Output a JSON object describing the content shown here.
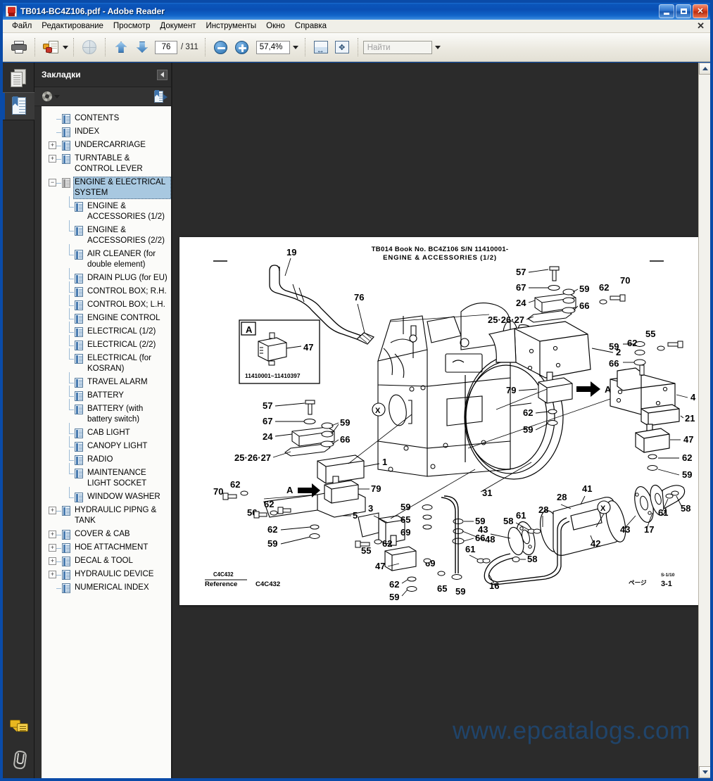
{
  "window": {
    "title": "TB014-BC4Z106.pdf - Adobe Reader",
    "app_icon": "pdf-icon",
    "minimize_label": "_",
    "maximize_label": "□",
    "close_label": "✕"
  },
  "menu": {
    "items": [
      {
        "label": "Файл",
        "accel": "Ф"
      },
      {
        "label": "Редактирование",
        "accel": "Р"
      },
      {
        "label": "Просмотр",
        "accel": "П"
      },
      {
        "label": "Документ",
        "accel": "Д"
      },
      {
        "label": "Инструменты",
        "accel": "И"
      },
      {
        "label": "Окно",
        "accel": "О"
      },
      {
        "label": "Справка",
        "accel": "С"
      }
    ],
    "close_toolbar_label": "✕"
  },
  "toolbar": {
    "print_icon": "printer-icon",
    "share_icon": "email-share-icon",
    "web_capture_icon": "globe-icon",
    "prev_page_icon": "arrow-up-icon",
    "next_page_icon": "arrow-down-icon",
    "current_page": "76",
    "page_total": "/ 311",
    "zoom_out_icon": "zoom-out-icon",
    "zoom_in_icon": "zoom-in-icon",
    "zoom_value": "57,4%",
    "zoom_dropdown_icon": "chevron-down-icon",
    "fit_width_icon": "fit-width-icon",
    "fit_page_icon": "fit-page-icon",
    "find_placeholder": "Найти",
    "find_value": "",
    "find_dropdown_icon": "chevron-down-icon"
  },
  "iconstrip": {
    "pages_icon": "page-thumbnails-icon",
    "bookmarks_icon": "bookmarks-panel-icon",
    "comments_icon": "comments-icon",
    "attachments_icon": "paperclip-icon"
  },
  "bookmarks_panel": {
    "title": "Закладки",
    "collapse_icon": "collapse-panel-icon",
    "options_icon": "gear-icon",
    "expand_current_icon": "expand-current-bookmark-icon",
    "items": [
      {
        "label": "CONTENTS",
        "level": 0,
        "toggle": "none",
        "selected": false
      },
      {
        "label": "INDEX",
        "level": 0,
        "toggle": "none",
        "selected": false
      },
      {
        "label": "UNDERCARRIAGE",
        "level": 0,
        "toggle": "plus",
        "selected": false
      },
      {
        "label": "TURNTABLE & CONTROL LEVER",
        "level": 0,
        "toggle": "plus",
        "selected": false
      },
      {
        "label": "ENGINE & ELECTRICAL SYSTEM",
        "level": 0,
        "toggle": "minus",
        "selected": true
      },
      {
        "label": "ENGINE & ACCESSORIES (1/2)",
        "level": 1,
        "toggle": "none",
        "selected": false
      },
      {
        "label": "ENGINE & ACCESSORIES (2/2)",
        "level": 1,
        "toggle": "none",
        "selected": false
      },
      {
        "label": "AIR CLEANER (for double element)",
        "level": 1,
        "toggle": "none",
        "selected": false
      },
      {
        "label": "DRAIN PLUG (for EU)",
        "level": 1,
        "toggle": "none",
        "selected": false
      },
      {
        "label": "CONTROL BOX; R.H.",
        "level": 1,
        "toggle": "none",
        "selected": false
      },
      {
        "label": "CONTROL BOX; L.H.",
        "level": 1,
        "toggle": "none",
        "selected": false
      },
      {
        "label": "ENGINE CONTROL",
        "level": 1,
        "toggle": "none",
        "selected": false
      },
      {
        "label": "ELECTRICAL (1/2)",
        "level": 1,
        "toggle": "none",
        "selected": false
      },
      {
        "label": "ELECTRICAL (2/2)",
        "level": 1,
        "toggle": "none",
        "selected": false
      },
      {
        "label": "ELECTRICAL (for KOSRAN)",
        "level": 1,
        "toggle": "none",
        "selected": false
      },
      {
        "label": "TRAVEL ALARM",
        "level": 1,
        "toggle": "none",
        "selected": false
      },
      {
        "label": "BATTERY",
        "level": 1,
        "toggle": "none",
        "selected": false
      },
      {
        "label": "BATTERY (with battery switch)",
        "level": 1,
        "toggle": "none",
        "selected": false
      },
      {
        "label": "CAB LIGHT",
        "level": 1,
        "toggle": "none",
        "selected": false
      },
      {
        "label": "CANOPY LIGHT",
        "level": 1,
        "toggle": "none",
        "selected": false
      },
      {
        "label": "RADIO",
        "level": 1,
        "toggle": "none",
        "selected": false
      },
      {
        "label": "MAINTENANCE LIGHT SOCKET",
        "level": 1,
        "toggle": "none",
        "selected": false
      },
      {
        "label": "WINDOW WASHER",
        "level": 1,
        "toggle": "none",
        "selected": false
      },
      {
        "label": "HYDRAULIC PIPNG & TANK",
        "level": 0,
        "toggle": "plus",
        "selected": false
      },
      {
        "label": "COVER & CAB",
        "level": 0,
        "toggle": "plus",
        "selected": false
      },
      {
        "label": "HOE ATTACHMENT",
        "level": 0,
        "toggle": "plus",
        "selected": false
      },
      {
        "label": "DECAL & TOOL",
        "level": 0,
        "toggle": "plus",
        "selected": false
      },
      {
        "label": "HYDRAULIC DEVICE",
        "level": 0,
        "toggle": "plus",
        "selected": false
      },
      {
        "label": "NUMERICAL INDEX",
        "level": 0,
        "toggle": "none",
        "selected": false
      }
    ]
  },
  "document": {
    "header_line1": "TB014   Book No.  BC4Z106   S/N 11410001-",
    "header_line2": "ENGINE & ACCESSORIES  (1/2)",
    "inset": {
      "tag": "A",
      "part_number": "47",
      "serial_range": "11410001~11410397"
    },
    "footer": {
      "reference_code_small": "C4C432",
      "reference_label": "Reference",
      "reference_code": "C4C432",
      "page_marker_jp": "ページ",
      "page_marker_value": "3-1",
      "page_marker_super": "S-1/10"
    },
    "callouts": [
      "19",
      "76",
      "57",
      "67",
      "24",
      "25·26·27",
      "59",
      "66",
      "70",
      "62",
      "2",
      "55",
      "4",
      "21",
      "47",
      "79",
      "A",
      "X",
      "31",
      "1",
      "5",
      "3",
      "56",
      "65",
      "69",
      "48",
      "41",
      "42",
      "43",
      "28",
      "61",
      "58",
      "17",
      "16",
      "59",
      "66"
    ],
    "labels_left_group": [
      "57",
      "67",
      "24",
      "25·26·27",
      "59",
      "66",
      "62",
      "70",
      "79",
      "56",
      "62",
      "5",
      "59",
      "1",
      "3",
      "55",
      "47",
      "69",
      "65"
    ],
    "labels_right_group": [
      "57",
      "67",
      "24",
      "59",
      "66",
      "62",
      "70",
      "2",
      "55",
      "4",
      "21",
      "47",
      "59",
      "62",
      "79",
      "28",
      "41",
      "42",
      "43",
      "61",
      "58",
      "17",
      "16"
    ]
  },
  "watermark": {
    "text": "www.epcatalogs.com"
  },
  "scrollbar": {
    "up_icon": "scroll-up-icon",
    "down_icon": "scroll-down-icon"
  }
}
